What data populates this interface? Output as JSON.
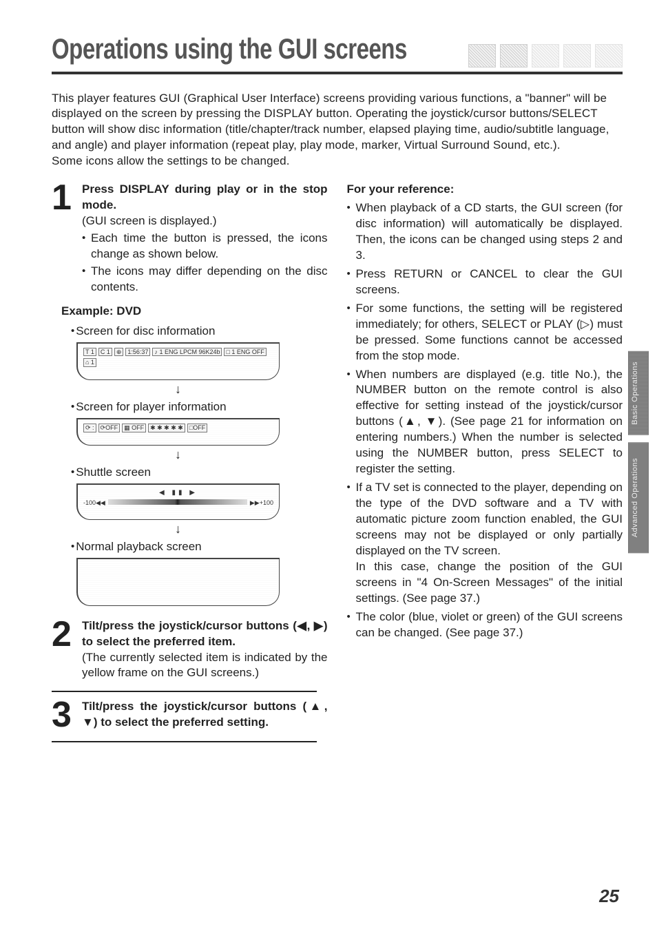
{
  "header": {
    "title": "Operations using the GUI screens",
    "icons": [
      "icon-a",
      "icon-b",
      "icon-c",
      "icon-d",
      "icon-e"
    ]
  },
  "intro": {
    "p1": "This player features GUI (Graphical User Interface) screens providing various functions, a \"banner\" will be displayed on the screen by pressing the DISPLAY button. Operating the joystick/cursor buttons/SELECT button will show disc information (title/chapter/track number, elapsed playing time, audio/subtitle language, and angle) and player information (repeat play, play mode, marker, Virtual Surround Sound, etc.).",
    "p2": "Some icons allow the settings to be changed."
  },
  "steps": {
    "s1": {
      "num": "1",
      "title": "Press DISPLAY during play or in the stop mode.",
      "sub": "(GUI screen is displayed.)",
      "b1": "Each time the button is pressed, the icons change as shown below.",
      "b2": "The icons may differ depending on the disc contents.",
      "example_label": "Example: DVD",
      "scr1_label": "Screen for disc information",
      "scr1_chips": [
        "T 1",
        "C 1",
        "⊕",
        "1:56:37",
        "♪ 1 ENG LPCM 96K24b",
        "□ 1 ENG OFF",
        "⌂ 1"
      ],
      "scr2_label": "Screen for player information",
      "scr2_chips": [
        "⟳ :",
        "⟳OFF",
        "▦ OFF",
        "✱ ✱ ✱ ✱ ✱",
        "□OFF"
      ],
      "scr3_label": "Shuttle screen",
      "scr3_left": "-100◀◀",
      "scr3_mid": "◀   ▮▮   ▶",
      "scr3_right": "▶▶+100",
      "scr4_label": "Normal playback screen"
    },
    "s2": {
      "num": "2",
      "title": "Tilt/press the joystick/cursor buttons (◀, ▶) to select the preferred item.",
      "sub": "(The currently selected item is indicated by the yellow frame on the GUI screens.)"
    },
    "s3": {
      "num": "3",
      "title": "Tilt/press the joystick/cursor buttons (▲, ▼) to select the preferred setting."
    }
  },
  "reference": {
    "head": "For your reference:",
    "b1": "When playback of a CD starts, the GUI screen (for disc information) will automatically be displayed. Then, the icons can be changed using steps 2 and 3.",
    "b2": "Press RETURN or CANCEL to clear the GUI screens.",
    "b3": "For some functions, the setting will be registered immediately; for others, SELECT or PLAY (▷) must be pressed. Some functions cannot be accessed from the stop mode.",
    "b4": "When numbers are displayed (e.g. title No.), the NUMBER button on the remote control is also effective for setting instead of the joystick/cursor buttons (▲, ▼). (See page 21 for information on entering numbers.) When the number is selected using the NUMBER button, press SELECT to register the setting.",
    "b5a": "If a TV set is connected to the player, depending on the type of the DVD software and a TV with automatic picture zoom function enabled, the GUI screens may not be displayed or only partially displayed on the TV screen.",
    "b5b": "In this case, change the position of the GUI screens in \"4 On-Screen Messages\" of the initial settings. (See page 37.)",
    "b6": "The color (blue, violet or green) of the GUI screens can be changed. (See page 37.)"
  },
  "sidetabs": {
    "t1": "Basic Operations",
    "t2": "Advanced Operations"
  },
  "page_number": "25"
}
